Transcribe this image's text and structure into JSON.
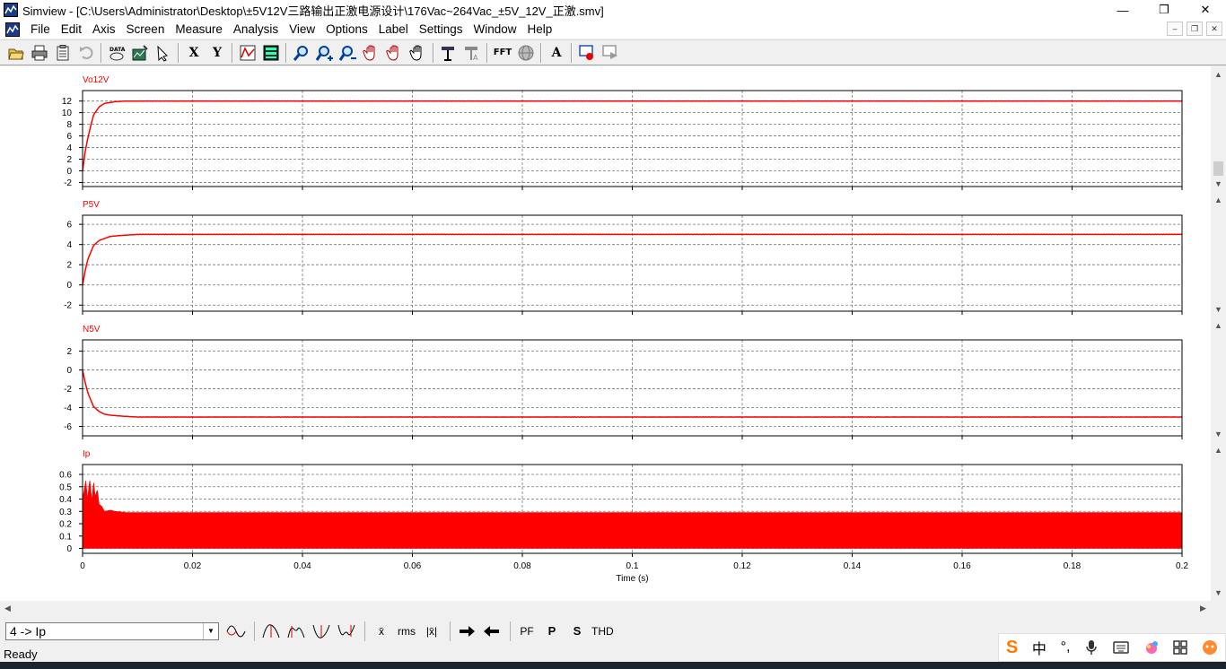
{
  "window": {
    "app_name": "Simview",
    "title": "Simview - [C:\\Users\\Administrator\\Desktop\\±5V12V三路输出正激电源设计\\176Vac~264Vac_±5V_12V_正激.smv]",
    "minimize": "—",
    "maximize": "❐",
    "close": "✕"
  },
  "menu": {
    "items": [
      "File",
      "Edit",
      "Axis",
      "Screen",
      "Measure",
      "Analysis",
      "View",
      "Options",
      "Label",
      "Settings",
      "Window",
      "Help"
    ],
    "mdi_buttons": [
      "–",
      "❐",
      "✕"
    ]
  },
  "toolbar": {
    "x_label": "X",
    "y_label": "Y",
    "data_label": "DATA",
    "fft_label": "FFT",
    "a_label": "A",
    "icons": [
      "open-icon",
      "print-icon",
      "clipboard-icon",
      "undo-icon",
      "data-icon",
      "chart-icon",
      "cursor-icon",
      "x-axis-icon",
      "y-axis-icon",
      "graph-icon",
      "table-icon",
      "zoom-icon",
      "zoom-in-icon",
      "zoom-out-icon",
      "pan-icon",
      "pan-vertical-icon",
      "hand-icon",
      "measure-icon",
      "measure-text-icon",
      "fft-icon",
      "sphere-icon",
      "font-icon",
      "record-icon",
      "playback-icon"
    ]
  },
  "plots": {
    "xlabel": "Time (s)",
    "x_ticks": [
      "0",
      "0.02",
      "0.04",
      "0.06",
      "0.08",
      "0.1",
      "0.12",
      "0.14",
      "0.16",
      "0.18",
      "0.2"
    ],
    "line_color": "#ff0000",
    "panels": [
      {
        "name": "Vo12V",
        "ticks": [
          "12",
          "10",
          "8",
          "6",
          "4",
          "2",
          "0",
          "-2"
        ]
      },
      {
        "name": "P5V",
        "ticks": [
          "6",
          "4",
          "2",
          "0",
          "-2"
        ]
      },
      {
        "name": "N5V",
        "ticks": [
          "2",
          "0",
          "-2",
          "-4",
          "-6"
        ]
      },
      {
        "name": "Ip",
        "ticks": [
          "0.6",
          "0.5",
          "0.4",
          "0.3",
          "0.2",
          "0.1",
          "0"
        ]
      }
    ]
  },
  "chart_data": [
    {
      "type": "line",
      "title": "Vo12V",
      "xlabel": "",
      "ylabel": "",
      "xlim": [
        0,
        0.2
      ],
      "ylim": [
        -2.7,
        13.8
      ],
      "grid": true,
      "series": [
        {
          "name": "Vo12V",
          "x": [
            0,
            0.0005,
            0.001,
            0.0015,
            0.002,
            0.003,
            0.004,
            0.006,
            0.008,
            0.01,
            0.05,
            0.1,
            0.15,
            0.2
          ],
          "values": [
            0,
            3.5,
            5.8,
            7.8,
            9.6,
            11.0,
            11.6,
            11.9,
            12.0,
            12.0,
            12.0,
            12.0,
            12.0,
            12.0
          ]
        }
      ]
    },
    {
      "type": "line",
      "title": "P5V",
      "xlabel": "",
      "ylabel": "",
      "xlim": [
        0,
        0.2
      ],
      "ylim": [
        -2.6,
        6.9
      ],
      "grid": true,
      "series": [
        {
          "name": "P5V",
          "x": [
            0,
            0.0005,
            0.001,
            0.002,
            0.003,
            0.004,
            0.005,
            0.007,
            0.01,
            0.05,
            0.1,
            0.15,
            0.2
          ],
          "values": [
            0,
            1.5,
            2.6,
            3.9,
            4.4,
            4.6,
            4.8,
            4.9,
            5.0,
            5.0,
            5.0,
            5.0,
            5.0
          ]
        }
      ]
    },
    {
      "type": "line",
      "title": "N5V",
      "xlabel": "",
      "ylabel": "",
      "xlim": [
        0,
        0.2
      ],
      "ylim": [
        -7,
        3.2
      ],
      "grid": true,
      "series": [
        {
          "name": "N5V",
          "x": [
            0,
            0.0005,
            0.001,
            0.002,
            0.003,
            0.004,
            0.005,
            0.007,
            0.01,
            0.05,
            0.1,
            0.15,
            0.2
          ],
          "values": [
            0,
            -1.4,
            -2.5,
            -3.9,
            -4.4,
            -4.7,
            -4.8,
            -4.9,
            -5.0,
            -5.0,
            -5.0,
            -5.0,
            -5.0
          ]
        }
      ]
    },
    {
      "type": "area",
      "title": "Ip",
      "xlabel": "Time (s)",
      "ylabel": "",
      "xlim": [
        0,
        0.2
      ],
      "ylim": [
        -0.04,
        0.68
      ],
      "grid": true,
      "series": [
        {
          "name": "Ip",
          "x": [
            0,
            0.0006,
            0.0009,
            0.0013,
            0.0017,
            0.002,
            0.0023,
            0.0027,
            0.003,
            0.0035,
            0.004,
            0.005,
            0.006,
            0.008,
            0.2
          ],
          "values": [
            0.4,
            0.55,
            0.4,
            0.56,
            0.38,
            0.55,
            0.42,
            0.48,
            0.36,
            0.34,
            0.3,
            0.31,
            0.3,
            0.29,
            0.29
          ]
        }
      ]
    }
  ],
  "bottombar": {
    "selected_variable": "4 -> Ip",
    "buttons": [
      "x̄",
      "rms",
      "|x̄|",
      "PF",
      "P",
      "S",
      "THD"
    ],
    "icons": [
      "sine-icon",
      "max-icon",
      "peak-icon",
      "min-icon",
      "valley-icon",
      "arrow-right-icon",
      "arrow-left-icon"
    ]
  },
  "status": {
    "text": "Ready"
  },
  "ime": {
    "logo": "S",
    "items": [
      "中",
      "°,",
      "mic-icon",
      "keyboard-icon",
      "skin-icon",
      "grid-icon",
      "user-icon"
    ]
  }
}
